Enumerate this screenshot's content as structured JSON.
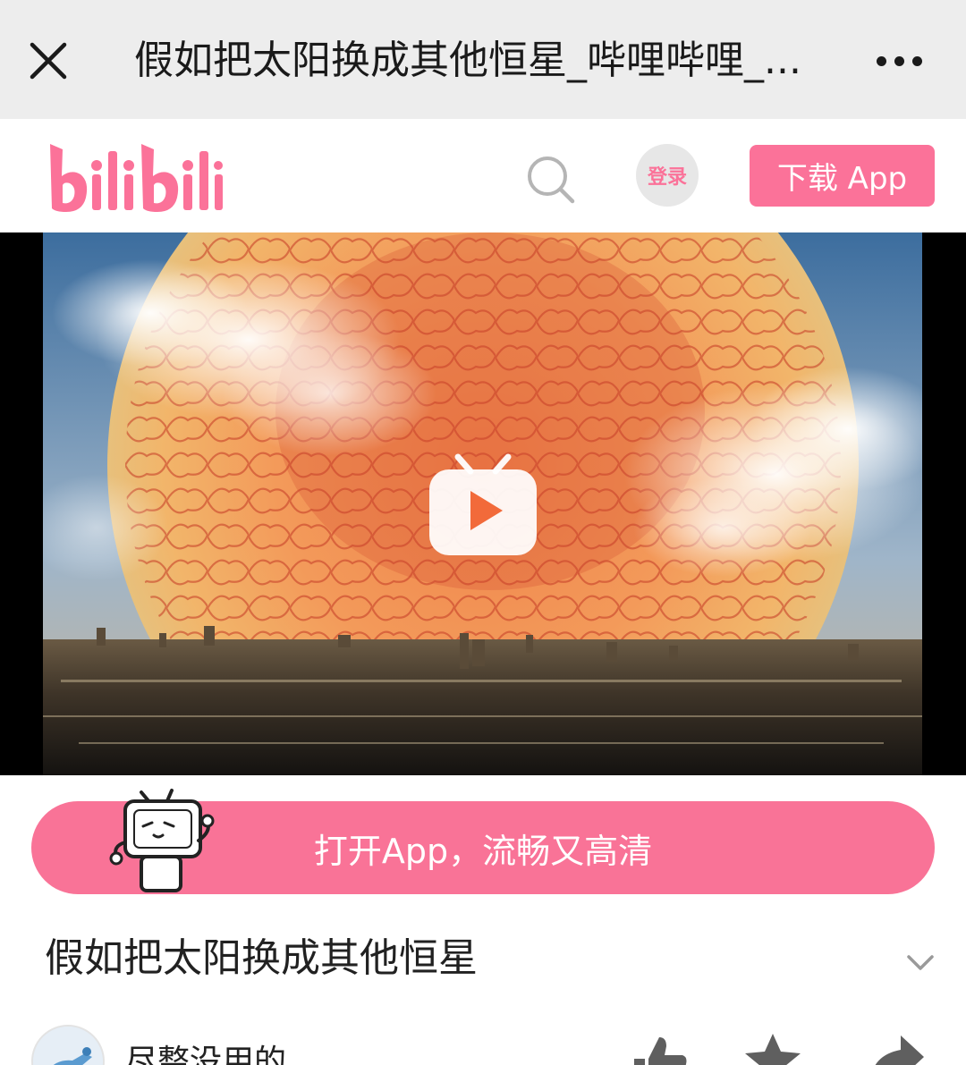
{
  "topbar": {
    "title": "假如把太阳换成其他恒星_哔哩哔哩_..."
  },
  "header": {
    "logo_text": "bilibili",
    "login_label": "登录",
    "download_label": "下载 App"
  },
  "banner": {
    "open_app_label": "打开App，流畅又高清"
  },
  "video": {
    "title": "假如把太阳换成其他恒星"
  },
  "uploader": {
    "name": "尽整没用的"
  },
  "colors": {
    "brand_pink": "#fb7299",
    "topbar_bg": "#ededed"
  },
  "icons": [
    "close-icon",
    "more-icon",
    "search-icon",
    "play-icon",
    "chevron-down-icon",
    "like-icon",
    "coin-icon",
    "share-icon"
  ]
}
